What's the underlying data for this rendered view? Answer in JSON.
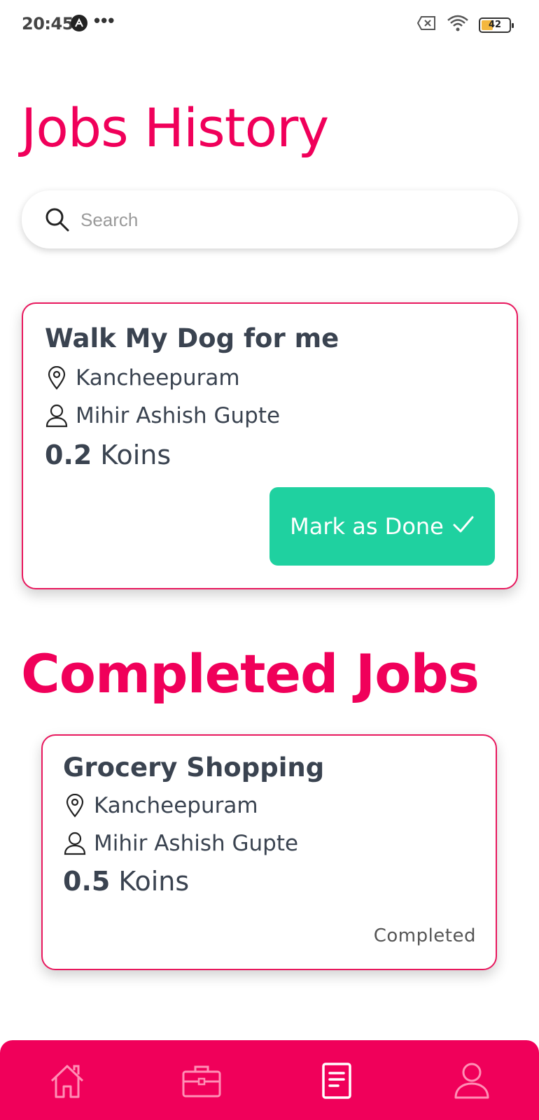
{
  "status_bar": {
    "time": "20:45",
    "dots": "•••",
    "battery": "42",
    "battery_level": 0.42,
    "icons": [
      "app-notification-icon",
      "sim-off-icon",
      "wifi-icon",
      "battery-icon"
    ]
  },
  "page": {
    "title": "Jobs History"
  },
  "search": {
    "placeholder": "Search",
    "value": ""
  },
  "active_jobs": [
    {
      "title": "Walk My Dog for me",
      "location": "Kancheepuram",
      "person": "Mihir Ashish Gupte",
      "koins_value": "0.2",
      "koins_unit": "Koins",
      "action_label": "Mark as Done"
    }
  ],
  "completed_section": {
    "title": "Completed Jobs"
  },
  "completed_jobs": [
    {
      "title": "Grocery Shopping",
      "location": "Kancheepuram",
      "person": "Mihir Ashish Gupte",
      "koins_value": "0.5",
      "koins_unit": "Koins",
      "status": "Completed"
    }
  ],
  "bottom_nav": {
    "items": [
      "home-icon",
      "briefcase-icon",
      "document-icon",
      "profile-icon"
    ],
    "active": "document-icon"
  },
  "colors": {
    "brand": "#f0005a",
    "accent_button": "#1fd1a0",
    "text": "#3a4350"
  }
}
